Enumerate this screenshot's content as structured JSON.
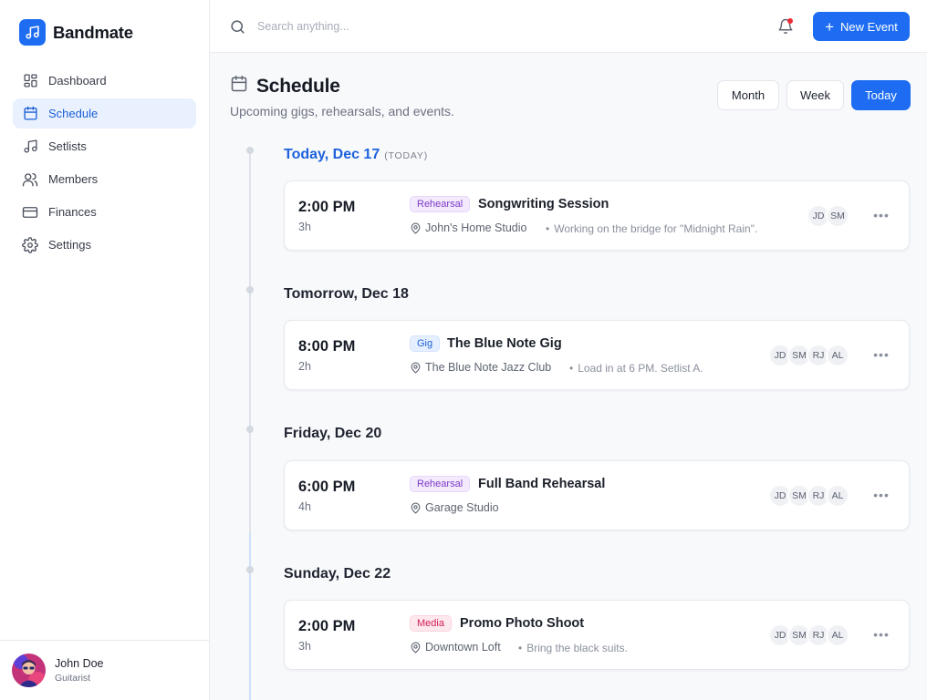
{
  "app": {
    "name": "Bandmate"
  },
  "sidebar": {
    "items": [
      {
        "label": "Dashboard",
        "icon": "grid-icon"
      },
      {
        "label": "Schedule",
        "icon": "calendar-icon",
        "active": true
      },
      {
        "label": "Setlists",
        "icon": "music-note-icon"
      },
      {
        "label": "Members",
        "icon": "users-icon"
      },
      {
        "label": "Finances",
        "icon": "credit-card-icon"
      },
      {
        "label": "Settings",
        "icon": "gear-icon"
      }
    ],
    "user": {
      "name": "John Doe",
      "role": "Guitarist"
    }
  },
  "topbar": {
    "search_placeholder": "Search anything...",
    "new_event_label": "New Event"
  },
  "page": {
    "title": "Schedule",
    "subtitle": "Upcoming gigs, rehearsals, and events.",
    "views": [
      "Month",
      "Week",
      "Today"
    ],
    "active_view": "Today"
  },
  "days": [
    {
      "label": "Today, Dec 17",
      "tag": "(TODAY)",
      "events": [
        {
          "time": "2:00 PM",
          "duration": "3h",
          "type": "Rehearsal",
          "title": "Songwriting Session",
          "location": "John's Home Studio",
          "note": "Working on the bridge for \"Midnight Rain\".",
          "members": [
            "JD",
            "SM"
          ]
        }
      ]
    },
    {
      "label": "Tomorrow, Dec 18",
      "events": [
        {
          "time": "8:00 PM",
          "duration": "2h",
          "type": "Gig",
          "title": "The Blue Note Gig",
          "location": "The Blue Note Jazz Club",
          "note": "Load in at 6 PM. Setlist A.",
          "members": [
            "JD",
            "SM",
            "RJ",
            "AL"
          ]
        }
      ]
    },
    {
      "label": "Friday, Dec 20",
      "events": [
        {
          "time": "6:00 PM",
          "duration": "4h",
          "type": "Rehearsal",
          "title": "Full Band Rehearsal",
          "location": "Garage Studio",
          "note": "",
          "members": [
            "JD",
            "SM",
            "RJ",
            "AL"
          ]
        }
      ]
    },
    {
      "label": "Sunday, Dec 22",
      "events": [
        {
          "time": "2:00 PM",
          "duration": "3h",
          "type": "Media",
          "title": "Promo Photo Shoot",
          "location": "Downtown Loft",
          "note": "Bring the black suits.",
          "members": [
            "JD",
            "SM",
            "RJ",
            "AL"
          ]
        }
      ]
    }
  ],
  "colors": {
    "accent": "#1d6cf2",
    "rehearsal": "#7d3ac8",
    "gig": "#1d5fd8",
    "media": "#d21e58",
    "notification": "#ef2b35"
  }
}
